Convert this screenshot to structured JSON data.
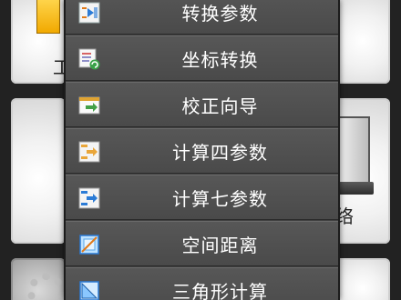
{
  "background": {
    "tile_top_left_text": "工",
    "tile_right_text": "络"
  },
  "menu": {
    "items": [
      {
        "label": "转换参数",
        "icon": "convert-params-icon"
      },
      {
        "label": "坐标转换",
        "icon": "coordinate-transform-icon"
      },
      {
        "label": "校正向导",
        "icon": "calibration-wizard-icon"
      },
      {
        "label": "计算四参数",
        "icon": "compute-four-params-icon"
      },
      {
        "label": "计算七参数",
        "icon": "compute-seven-params-icon"
      },
      {
        "label": "空间距离",
        "icon": "spatial-distance-icon"
      },
      {
        "label": "三角形计算",
        "icon": "triangle-calc-icon"
      }
    ]
  },
  "colors": {
    "menu_background": "#4f4f4f",
    "menu_text": "#ffffff",
    "tile_light": "#f1f1f1"
  }
}
